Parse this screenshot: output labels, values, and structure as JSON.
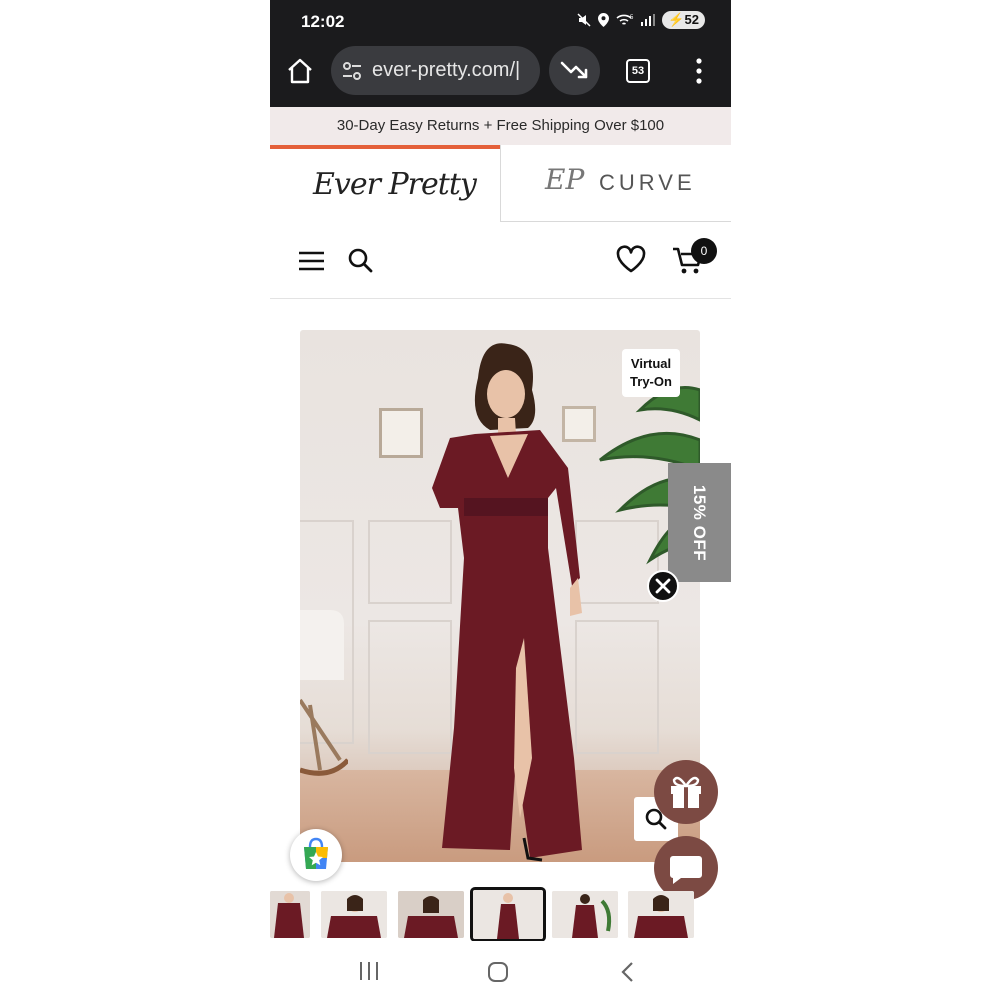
{
  "status_bar": {
    "time": "12:02",
    "battery": "52",
    "wifi_label": "5"
  },
  "browser": {
    "url": "ever-pretty.com/|",
    "tab_count": "53"
  },
  "promo_banner": {
    "text": "30-Day Easy Returns + Free Shipping Over $100"
  },
  "brand_tabs": {
    "ever_pretty": "Ever Pretty",
    "curve_mark": "EP",
    "curve": "CURVE",
    "active": "ever_pretty"
  },
  "header": {
    "cart_count": "0"
  },
  "product": {
    "virtual_try_on_line1": "Virtual",
    "virtual_try_on_line2": "Try-On",
    "dress_color": "#6b1a24",
    "thumbnail_count": 6,
    "active_thumbnail": 4
  },
  "side_promo": {
    "discount_label": "15% OFF"
  },
  "icons": [
    "home-icon",
    "site-settings-icon",
    "trending-down-icon",
    "tabs-icon",
    "more-vert-icon",
    "menu-icon",
    "search-icon",
    "heart-icon",
    "cart-icon",
    "close-icon",
    "gift-icon",
    "chat-icon",
    "zoom-icon",
    "shopping-bag-icon",
    "recent-apps-icon",
    "home-nav-icon",
    "back-icon"
  ],
  "colors": {
    "accent": "#e4603a",
    "promo_bg": "#f1eaea",
    "chrome_bg": "#1b1b1d",
    "button_brown": "#7c4a43"
  }
}
